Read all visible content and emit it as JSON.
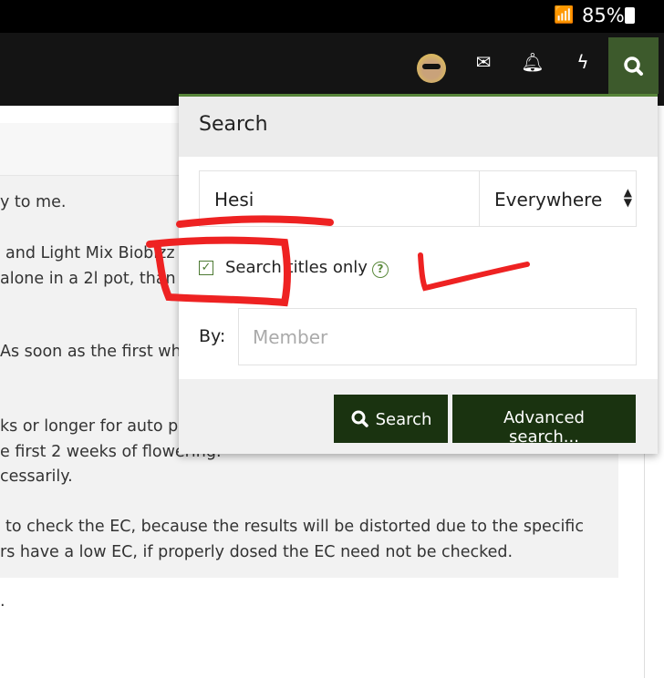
{
  "status_bar": {
    "battery": "85%",
    "wifi_icon": "wifi-icon",
    "battery_icon": "battery-icon"
  },
  "nav": {
    "icons": [
      "avatar",
      "envelope-icon",
      "bell-icon",
      "bolt-icon",
      "search-icon"
    ]
  },
  "content": {
    "lines": [
      "y to me.",
      "and Light Mix Biobizz",
      "alone in a 2l pot, than",
      "As soon as the first wh",
      "ks or longer for auto pl",
      "e first 2 weeks of flowering.",
      "cessarily.",
      "to check the EC, because the results will be distorted due to the specific",
      "rs have a low EC, if properly dosed the EC need not be checked.",
      "."
    ]
  },
  "search_popup": {
    "title": "Search",
    "query_value": "Hesi",
    "scope_value": "Everywhere",
    "titles_only_label": "Search titles only",
    "titles_only_checked": true,
    "help": "?",
    "by_label": "By:",
    "member_placeholder": "Member",
    "search_button": "Search",
    "advanced_button": "Advanced search..."
  },
  "colors": {
    "accent": "#3d5a2c",
    "button": "#1a3310",
    "annotation": "#ee2222"
  }
}
